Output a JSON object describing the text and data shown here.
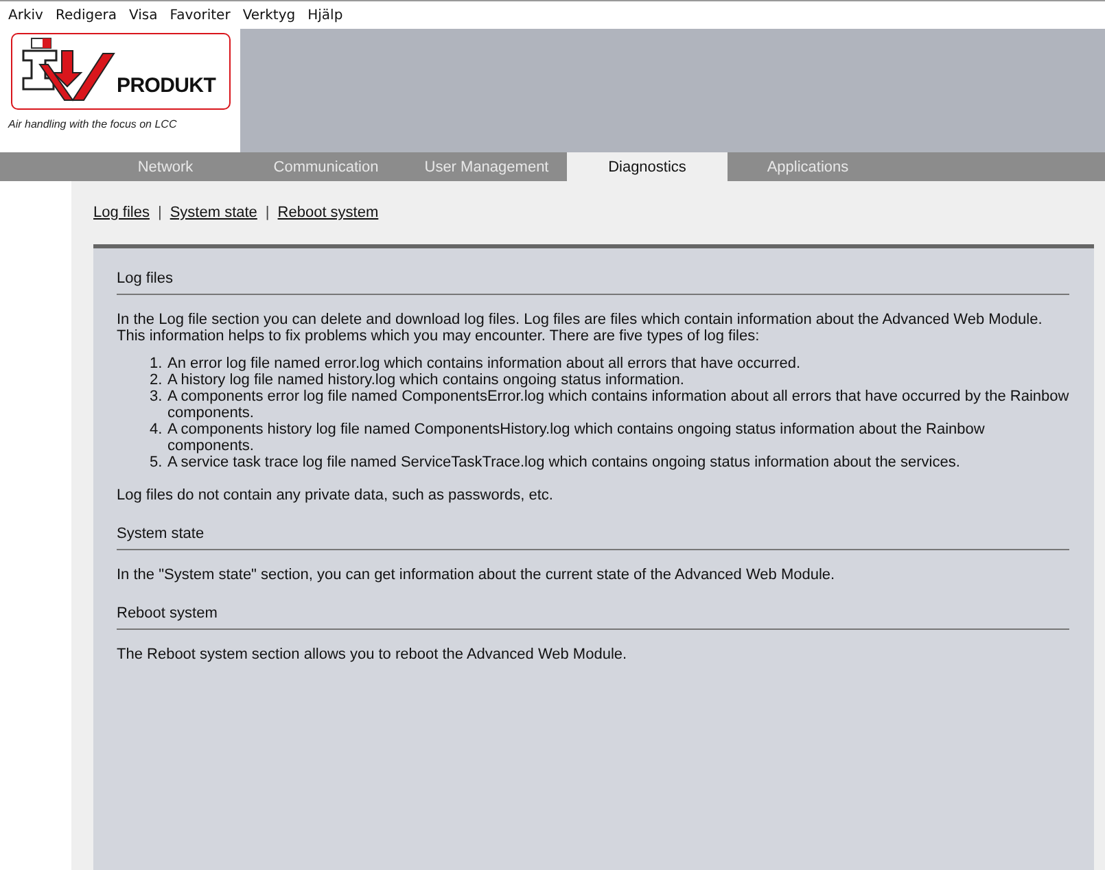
{
  "menu_bar": [
    "Arkiv",
    "Redigera",
    "Visa",
    "Favoriter",
    "Verktyg",
    "Hjälp"
  ],
  "logo": {
    "brand": "PRODUKT",
    "tagline": "Air handling with the focus on LCC"
  },
  "tabs": [
    {
      "label": "Network",
      "selected": false
    },
    {
      "label": "Communication",
      "selected": false
    },
    {
      "label": "User Management",
      "selected": false
    },
    {
      "label": "Diagnostics",
      "selected": true
    },
    {
      "label": "Applications",
      "selected": false
    }
  ],
  "sub_nav": [
    {
      "kind": "link",
      "label": "Log files"
    },
    {
      "kind": "separator",
      "label": "|"
    },
    {
      "kind": "link",
      "label": "System state"
    },
    {
      "kind": "separator",
      "label": "|"
    },
    {
      "kind": "link",
      "label": "Reboot system"
    }
  ],
  "sections": [
    {
      "title": "Log files",
      "paragraphs": [
        "In the Log file section you can delete and download log files. Log files are files which contain information about the Advanced Web Module. This information helps to fix problems which you may encounter. There are five types of log files:"
      ],
      "list": [
        {
          "number": "1.",
          "text": "An error log file named error.log which contains information about all errors that have occurred."
        },
        {
          "number": "2.",
          "text": "A history log file named history.log which contains ongoing status information."
        },
        {
          "number": "3.",
          "text": "A components error log file named ComponentsError.log which contains information about all errors that have occurred by the Rainbow components."
        },
        {
          "number": "4.",
          "text": "A components history log file named ComponentsHistory.log which contains ongoing status information about the Rainbow components."
        },
        {
          "number": "5.",
          "text": "A service task trace log file named ServiceTaskTrace.log which contains ongoing status information about the services."
        }
      ],
      "after": [
        "Log files do not contain any private data, such as passwords, etc."
      ]
    },
    {
      "title": "System state",
      "paragraphs": [
        "In the \"System state\" section, you can get information about the current state of the Advanced Web Module."
      ]
    },
    {
      "title": "Reboot system",
      "paragraphs": [
        "The Reboot system section allows you to reboot the Advanced Web Module."
      ]
    }
  ]
}
